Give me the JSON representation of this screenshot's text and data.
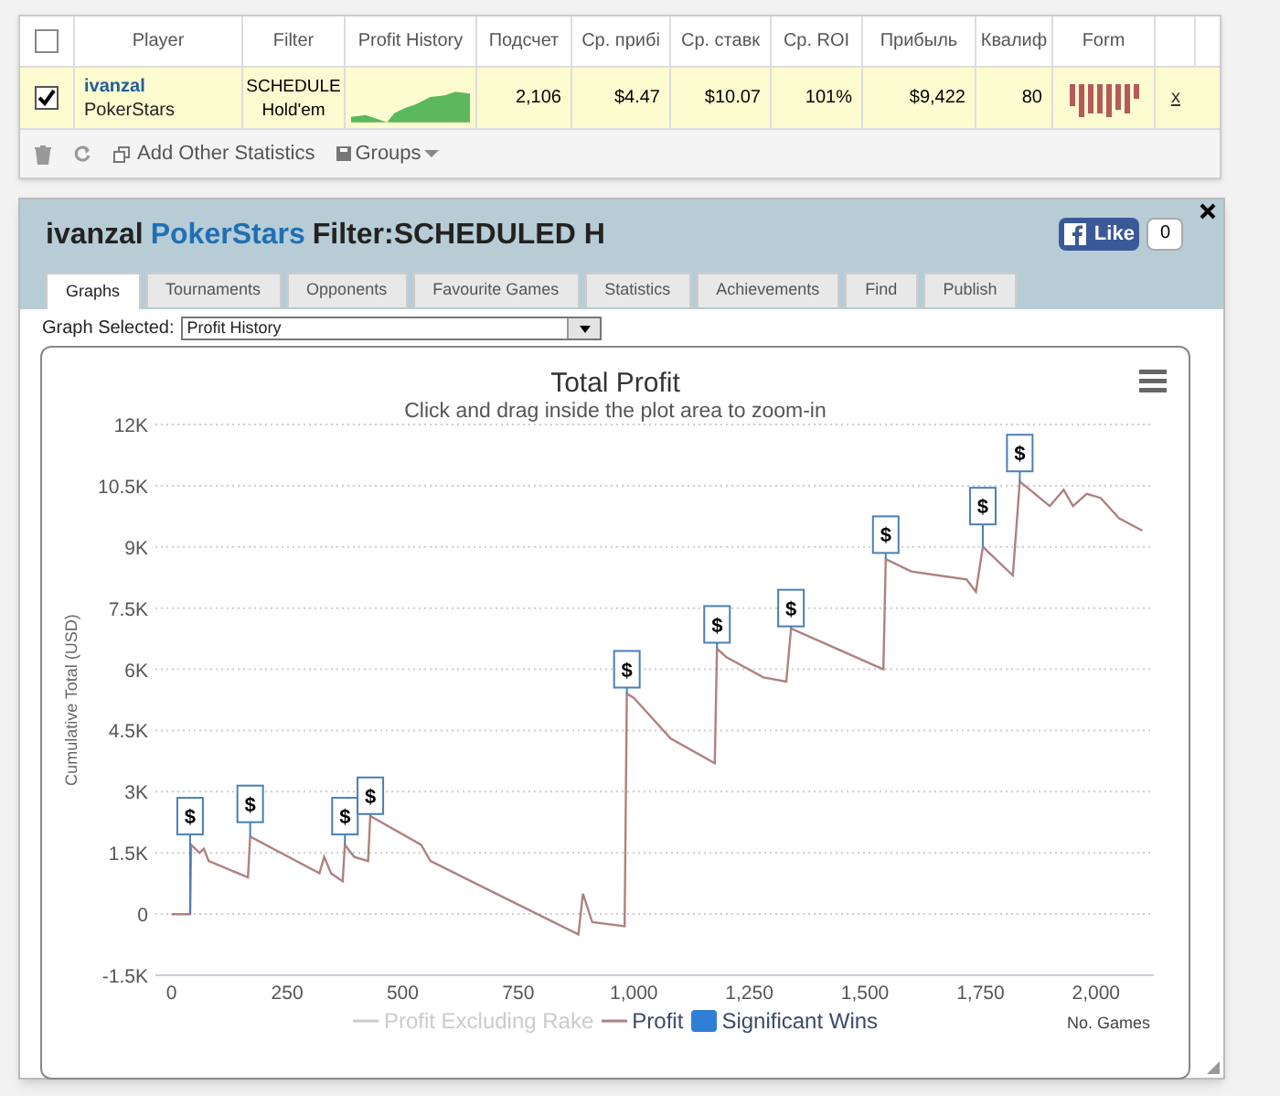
{
  "stats_table": {
    "all_checked": false,
    "columns": [
      "",
      "Player",
      "Filter",
      "Profit History",
      "Подсчет",
      "Ср. прибі",
      "Ср. ставк",
      "Ср. ROI",
      "Прибыль",
      "Квалиф",
      "Form",
      ""
    ],
    "rows": [
      {
        "checked": true,
        "player": "ivanzal",
        "site": "PokerStars",
        "filter": [
          "SCHEDULE",
          "Hold'em"
        ],
        "values": [
          "2,106",
          "$4.47",
          "$10.07",
          "101%",
          "$9,422",
          "80"
        ],
        "remove": "x"
      }
    ],
    "toolbar": {
      "add": "Add Other Statistics",
      "groups": "Groups"
    }
  },
  "panel": {
    "player": "ivanzal",
    "site": "PokerStars",
    "filter_label": "Filter:",
    "filter": "SCHEDULED H",
    "like": "Like",
    "like_count": "0",
    "tabs": [
      {
        "label": "Graphs",
        "selected": true
      },
      {
        "label": "Tournaments",
        "selected": false
      },
      {
        "label": "Opponents",
        "selected": false
      },
      {
        "label": "Favourite Games",
        "selected": false
      },
      {
        "label": "Statistics",
        "selected": false
      },
      {
        "label": "Achievements",
        "selected": false
      },
      {
        "label": "Find",
        "selected": false
      },
      {
        "label": "Publish",
        "selected": false
      }
    ],
    "graph_selected_label": "Graph Selected:",
    "graph_selected": "Profit History",
    "legend": [
      {
        "label": "Profit Excluding Rake",
        "kind": "line",
        "hidden": true
      },
      {
        "label": "Significant Wins",
        "kind": "flag",
        "hidden": false
      }
    ],
    "chart_data": {
      "type": "line",
      "title": "Total Profit",
      "subtitle": "Click and drag inside the plot area to zoom-in",
      "xlabel": "No. Games",
      "ylabel": "Cumulative Total (USD)",
      "grid": true,
      "x": [
        0,
        40,
        42,
        60,
        70,
        80,
        165,
        170,
        320,
        330,
        345,
        370,
        375,
        395,
        425,
        430,
        540,
        560,
        880,
        890,
        910,
        980,
        985,
        1000,
        1080,
        1175,
        1180,
        1200,
        1280,
        1330,
        1340,
        1400,
        1540,
        1545,
        1600,
        1720,
        1740,
        1755,
        1820,
        1835,
        1900,
        1930,
        1950,
        1980,
        2010,
        2050,
        2100
      ],
      "series": [
        {
          "name": "Profit",
          "color": "#b08080",
          "values": [
            0,
            0,
            1700,
            1500,
            1600,
            1300,
            900,
            1900,
            1000,
            1400,
            1000,
            800,
            1700,
            1400,
            1300,
            2400,
            1700,
            1300,
            -500,
            500,
            -200,
            -300,
            5400,
            5300,
            4300,
            3700,
            6500,
            6300,
            5800,
            5700,
            7000,
            6700,
            6000,
            8700,
            8400,
            8200,
            7900,
            9000,
            8300,
            10600,
            10000,
            10400,
            10000,
            10300,
            10200,
            9700,
            9400
          ]
        }
      ],
      "xlim": [
        -35,
        2125
      ],
      "xticks": [
        {
          "value": 0,
          "label": "0"
        },
        {
          "value": 250,
          "label": "250"
        },
        {
          "value": 500,
          "label": "500"
        },
        {
          "value": 750,
          "label": "750"
        },
        {
          "value": 1000,
          "label": "1,000"
        },
        {
          "value": 1250,
          "label": "1,250"
        },
        {
          "value": 1500,
          "label": "1,500"
        },
        {
          "value": 1750,
          "label": "1,750"
        },
        {
          "value": 2000,
          "label": "2,000"
        }
      ],
      "yticks": [
        {
          "value": -1500,
          "label": "-1.5K"
        },
        {
          "value": 0,
          "label": "0"
        },
        {
          "value": 1500,
          "label": "1.5K"
        },
        {
          "value": 3000,
          "label": "3K"
        },
        {
          "value": 4500,
          "label": "4.5K"
        },
        {
          "value": 6000,
          "label": "6K"
        },
        {
          "value": 7500,
          "label": "7.5K"
        },
        {
          "value": 9000,
          "label": "9K"
        },
        {
          "value": 10500,
          "label": "10.5K"
        },
        {
          "value": 12000,
          "label": "12K"
        }
      ],
      "ylim": [
        -1500,
        12000
      ],
      "annotations": [
        {
          "x": 40,
          "y": 2400,
          "text": "$"
        },
        {
          "x": 170,
          "y": 2700,
          "text": "$"
        },
        {
          "x": 375,
          "y": 2400,
          "text": "$"
        },
        {
          "x": 430,
          "y": 2900,
          "text": "$"
        },
        {
          "x": 985,
          "y": 6000,
          "text": "$"
        },
        {
          "x": 1180,
          "y": 7100,
          "text": "$"
        },
        {
          "x": 1340,
          "y": 7500,
          "text": "$"
        },
        {
          "x": 1545,
          "y": 9300,
          "text": "$"
        },
        {
          "x": 1755,
          "y": 10000,
          "text": "$"
        },
        {
          "x": 1835,
          "y": 11300,
          "text": "$"
        }
      ]
    }
  }
}
